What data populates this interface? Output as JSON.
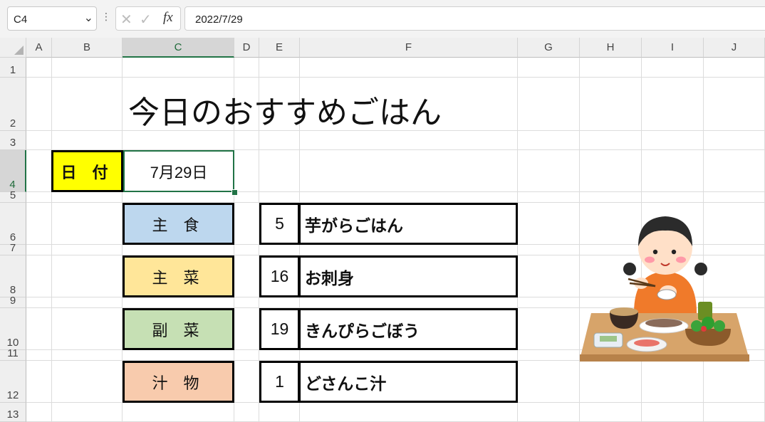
{
  "formula_bar": {
    "name_box": "C4",
    "formula": "2022/7/29",
    "fx_label": "fx"
  },
  "columns": [
    "A",
    "B",
    "C",
    "D",
    "E",
    "F",
    "G",
    "H",
    "I",
    "J"
  ],
  "selected_column": "C",
  "rows": [
    "1",
    "2",
    "3",
    "4",
    "5",
    "6",
    "7",
    "8",
    "9",
    "10",
    "11",
    "12",
    "13"
  ],
  "selected_row": "4",
  "title": "今日のおすすめごはん",
  "date": {
    "label": "日 付",
    "value": "7月29日"
  },
  "menu": [
    {
      "category": "主 食",
      "color": "#bdd7ee",
      "number": "5",
      "dish": "芋がらごはん"
    },
    {
      "category": "主 菜",
      "color": "#ffe699",
      "number": "16",
      "dish": "お刺身"
    },
    {
      "category": "副 菜",
      "color": "#c6e0b4",
      "number": "19",
      "dish": "きんぴらごぼう"
    },
    {
      "category": "汁 物",
      "color": "#f8cbad",
      "number": "1",
      "dish": "どさんこ汁"
    }
  ],
  "colors": {
    "accent": "#217346",
    "date_label_bg": "#ffff00"
  }
}
